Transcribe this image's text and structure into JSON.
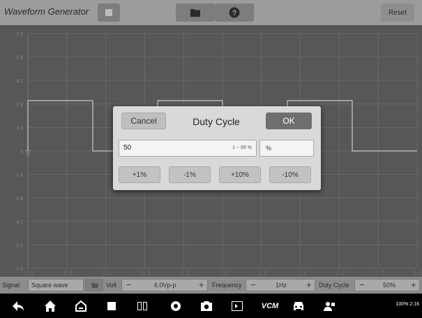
{
  "app": {
    "title": "Waveform Generator",
    "reset_label": "Reset"
  },
  "chart": {
    "y_ticks": [
      "7.0",
      "5.6",
      "4.2",
      "2.8",
      "1.4",
      "0",
      "-1.4",
      "-2.8",
      "-4.2",
      "-5.6",
      "-7.0"
    ],
    "x_ticks": [
      "0.0",
      "0.3",
      "0.6",
      "0.9",
      "1.2",
      "1.5",
      "1.8",
      "2.1",
      "2.4",
      "2.7",
      "3.0s"
    ]
  },
  "dialog": {
    "cancel_label": "Cancel",
    "title": "Duty Cycle",
    "ok_label": "OK",
    "value": "50",
    "range": "1 ~ 99 %",
    "unit": "%",
    "steps": [
      "+1%",
      "-1%",
      "+10%",
      "-10%"
    ]
  },
  "controls": {
    "signal_label": "Signal",
    "signal_value": "Square wave",
    "volt_label": "Volt",
    "volt_value": "6.0Vp-p",
    "frequency_label": "Frequency",
    "frequency_value": "1Hz",
    "duty_label": "Duty Cycle",
    "duty_value": "50%",
    "minus": "−",
    "plus": "+"
  },
  "status": {
    "text": "100% 2:16"
  },
  "colors": {
    "wave": "#c9c9c9",
    "grid": "#6a6a6a",
    "dialog_bg": "#d9d9d9",
    "ok_bg": "#6f6f6f"
  }
}
